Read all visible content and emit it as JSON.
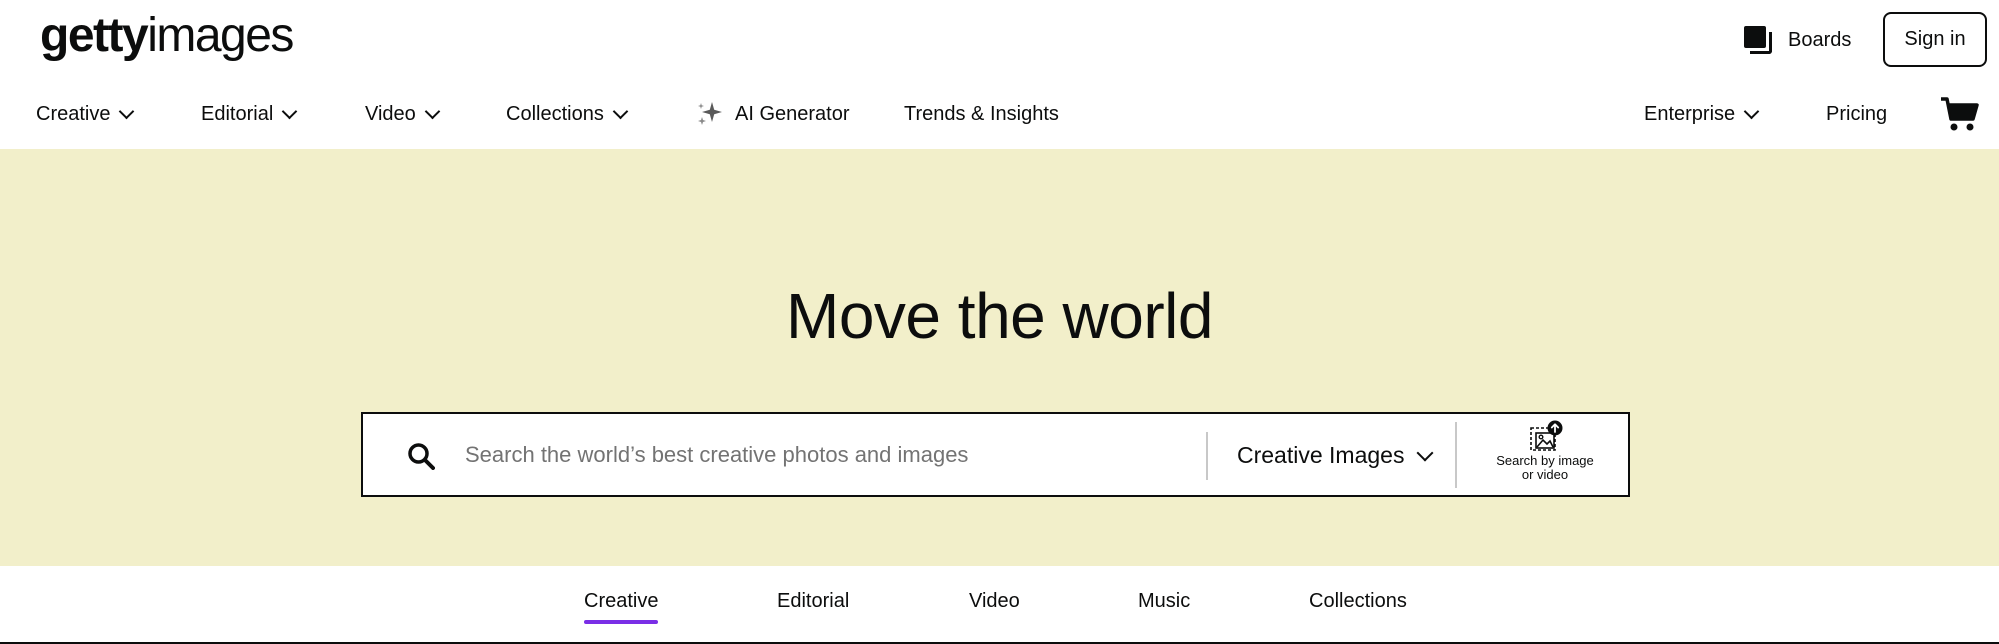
{
  "header": {
    "logo": {
      "bold": "getty",
      "light": "images"
    },
    "boards_label": "Boards",
    "signin_label": "Sign in"
  },
  "nav": {
    "items": [
      {
        "label": "Creative",
        "dropdown": true
      },
      {
        "label": "Editorial",
        "dropdown": true
      },
      {
        "label": "Video",
        "dropdown": true
      },
      {
        "label": "Collections",
        "dropdown": true
      },
      {
        "label": "AI Generator",
        "icon": "sparkle-icon"
      },
      {
        "label": "Trends & Insights"
      }
    ],
    "right_items": [
      {
        "label": "Enterprise",
        "dropdown": true
      },
      {
        "label": "Pricing"
      }
    ]
  },
  "hero": {
    "title": "Move the world",
    "background": "#f2efca"
  },
  "search": {
    "placeholder": "Search the world’s best creative photos and images",
    "value": "",
    "type_selected": "Creative Images",
    "image_search_label": "Search by image or video"
  },
  "tabs": {
    "items": [
      "Creative",
      "Editorial",
      "Video",
      "Music",
      "Collections"
    ],
    "active": "Creative",
    "accent": "#7a2ee6"
  }
}
